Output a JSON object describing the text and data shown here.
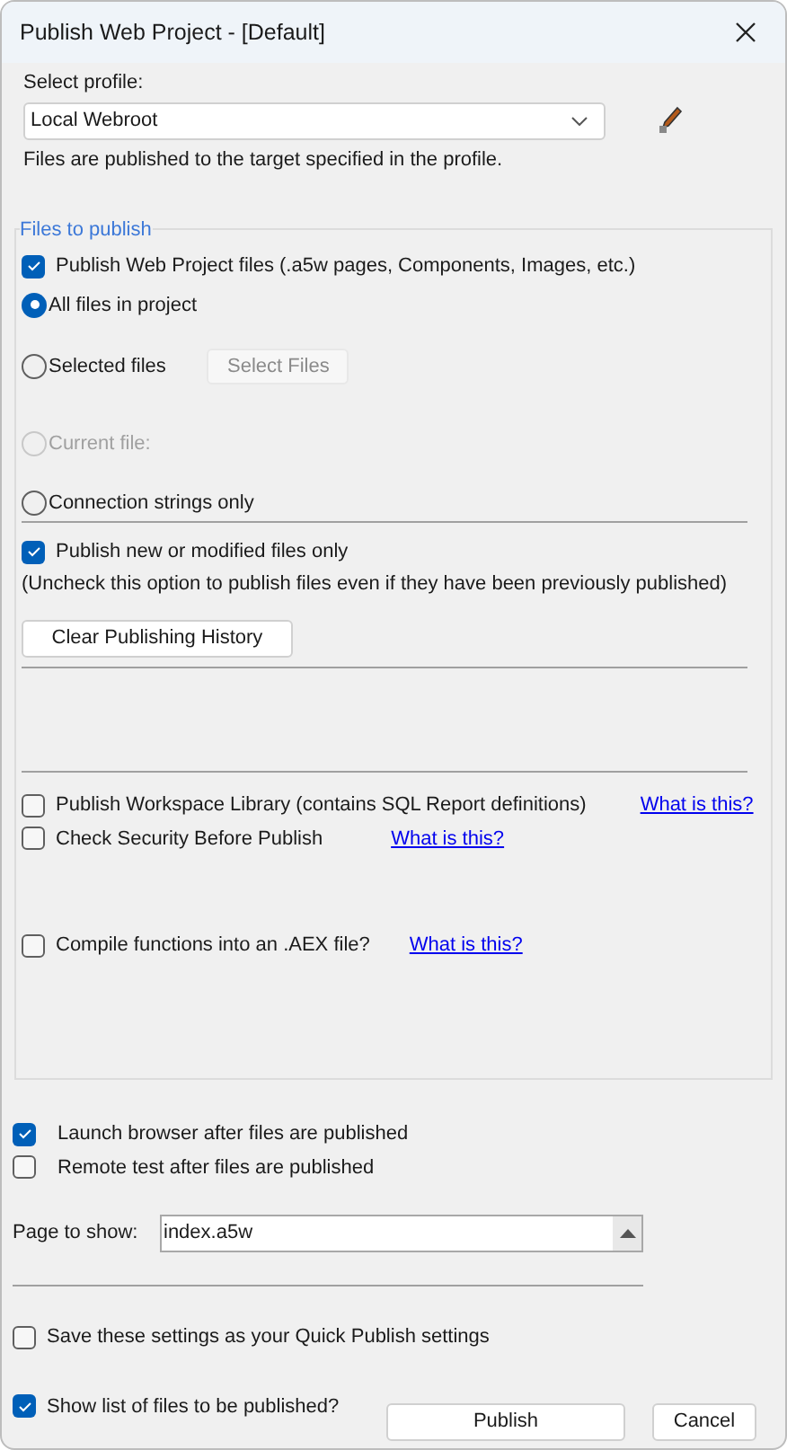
{
  "window": {
    "title": "Publish Web Project - [Default]"
  },
  "profile": {
    "label": "Select profile:",
    "value": "Local Webroot",
    "note": "Files are published to the target specified in the profile."
  },
  "files_group": {
    "title": "Files to publish",
    "publish_project": {
      "label": "Publish Web Project files (.a5w pages, Components, Images, etc.)",
      "checked": true
    },
    "scope": [
      {
        "label": "All files in project",
        "selected": true,
        "disabled": false
      },
      {
        "label": "Selected files",
        "selected": false,
        "disabled": false,
        "button": "Select Files",
        "button_disabled": true
      },
      {
        "label": "Current file:",
        "selected": false,
        "disabled": true
      },
      {
        "label": "Connection strings only",
        "selected": false,
        "disabled": false
      }
    ],
    "new_only": {
      "label": "Publish new or modified files only",
      "checked": true,
      "note": "(Uncheck this option to publish files even if they have been previously published)"
    },
    "clear_button": "Clear Publishing History",
    "options": [
      {
        "label": "Publish Workspace Library (contains SQL Report definitions)",
        "checked": false,
        "link": "What is this?"
      },
      {
        "label": "Check Security Before Publish",
        "checked": false,
        "link": "What is this?"
      },
      {
        "label": "Compile functions into an .AEX file?",
        "checked": false,
        "link": "What is this?"
      }
    ]
  },
  "after": [
    {
      "label": "Launch browser after files are published",
      "checked": true
    },
    {
      "label": "Remote test after files are published",
      "checked": false
    }
  ],
  "page_to_show": {
    "label": "Page to show:",
    "value": "index.a5w"
  },
  "save_quick": {
    "label": "Save these settings as your Quick Publish settings",
    "checked": false
  },
  "show_list": {
    "label": "Show list of files to be published?",
    "checked": true
  },
  "buttons": [
    "Publish",
    "Cancel"
  ]
}
